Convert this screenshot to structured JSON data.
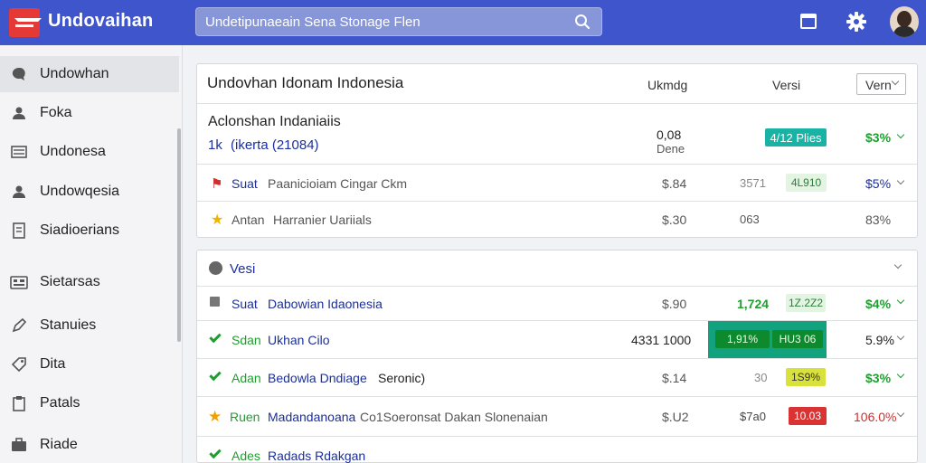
{
  "header": {
    "app_title": "Undovaihan",
    "search_placeholder": "Undetipunaeain Sena Stonage Flen"
  },
  "sidebar": {
    "items": [
      {
        "label": "Undowhan",
        "icon": "chat-icon"
      },
      {
        "label": "Foka",
        "icon": "person-icon"
      },
      {
        "label": "Undonesa",
        "icon": "list-icon"
      },
      {
        "label": "Undowqesia",
        "icon": "person-icon"
      },
      {
        "label": "Siadioerians",
        "icon": "document-icon"
      },
      {
        "label": "Sietarsas",
        "icon": "calculator-icon"
      },
      {
        "label": "Stanuies",
        "icon": "pen-icon"
      },
      {
        "label": "Dita",
        "icon": "tag-icon"
      },
      {
        "label": "Patals",
        "icon": "clipboard-icon"
      },
      {
        "label": "Riade",
        "icon": "briefcase-icon"
      }
    ]
  },
  "card1": {
    "title": "Undovhan Idonam Indonesia",
    "col_ranking": "Ukmdg",
    "col_version": "Versi",
    "version_select": "Vern",
    "featured": {
      "name": "Aclonshan Indaniaiis",
      "sub_prefix": "1k",
      "sub_text": "(ikerta (21084)",
      "value": "0,08",
      "value_sub": "Dene",
      "badge": "4/12 Plies",
      "pct": "$3%"
    },
    "rows": [
      {
        "code": "Suat",
        "name": "Paanicioiam Cingar Ckm",
        "price": "$.84",
        "stat": "3571",
        "badge": "4L910",
        "pct": "$5%"
      },
      {
        "code": "Antan",
        "name": "Harranier Uariials",
        "price": "$.30",
        "stat": "063",
        "badge": "",
        "pct": "83%"
      }
    ]
  },
  "card2": {
    "title": "Vesi",
    "rows": [
      {
        "code": "Suat",
        "name": "Dabowian Idaonesia",
        "price": "$.90",
        "stat": "1,724",
        "badge": "1Z.2Z2",
        "pct": "$4%"
      },
      {
        "code": "Sdan",
        "name": "Ukhan Cilo",
        "price": "4331 1000",
        "stat": "1,91%",
        "badge": "HU3 06",
        "pct": "5.9%"
      },
      {
        "code": "Adan",
        "name": "Bedowla Dndiage",
        "name_tail": "Seronic)",
        "price": "$.14",
        "stat": "30",
        "badge": "1S9%",
        "pct": "$3%"
      },
      {
        "code": "Ruen",
        "name": "Madandanoana",
        "name_tail": "Co1Soeronsat Dakan Slonenaian",
        "price": "$.U2",
        "stat": "$7a0",
        "badge": "10.03",
        "pct": "106.0%"
      },
      {
        "code": "Ades",
        "name": "Radads Rdakgan"
      }
    ]
  }
}
